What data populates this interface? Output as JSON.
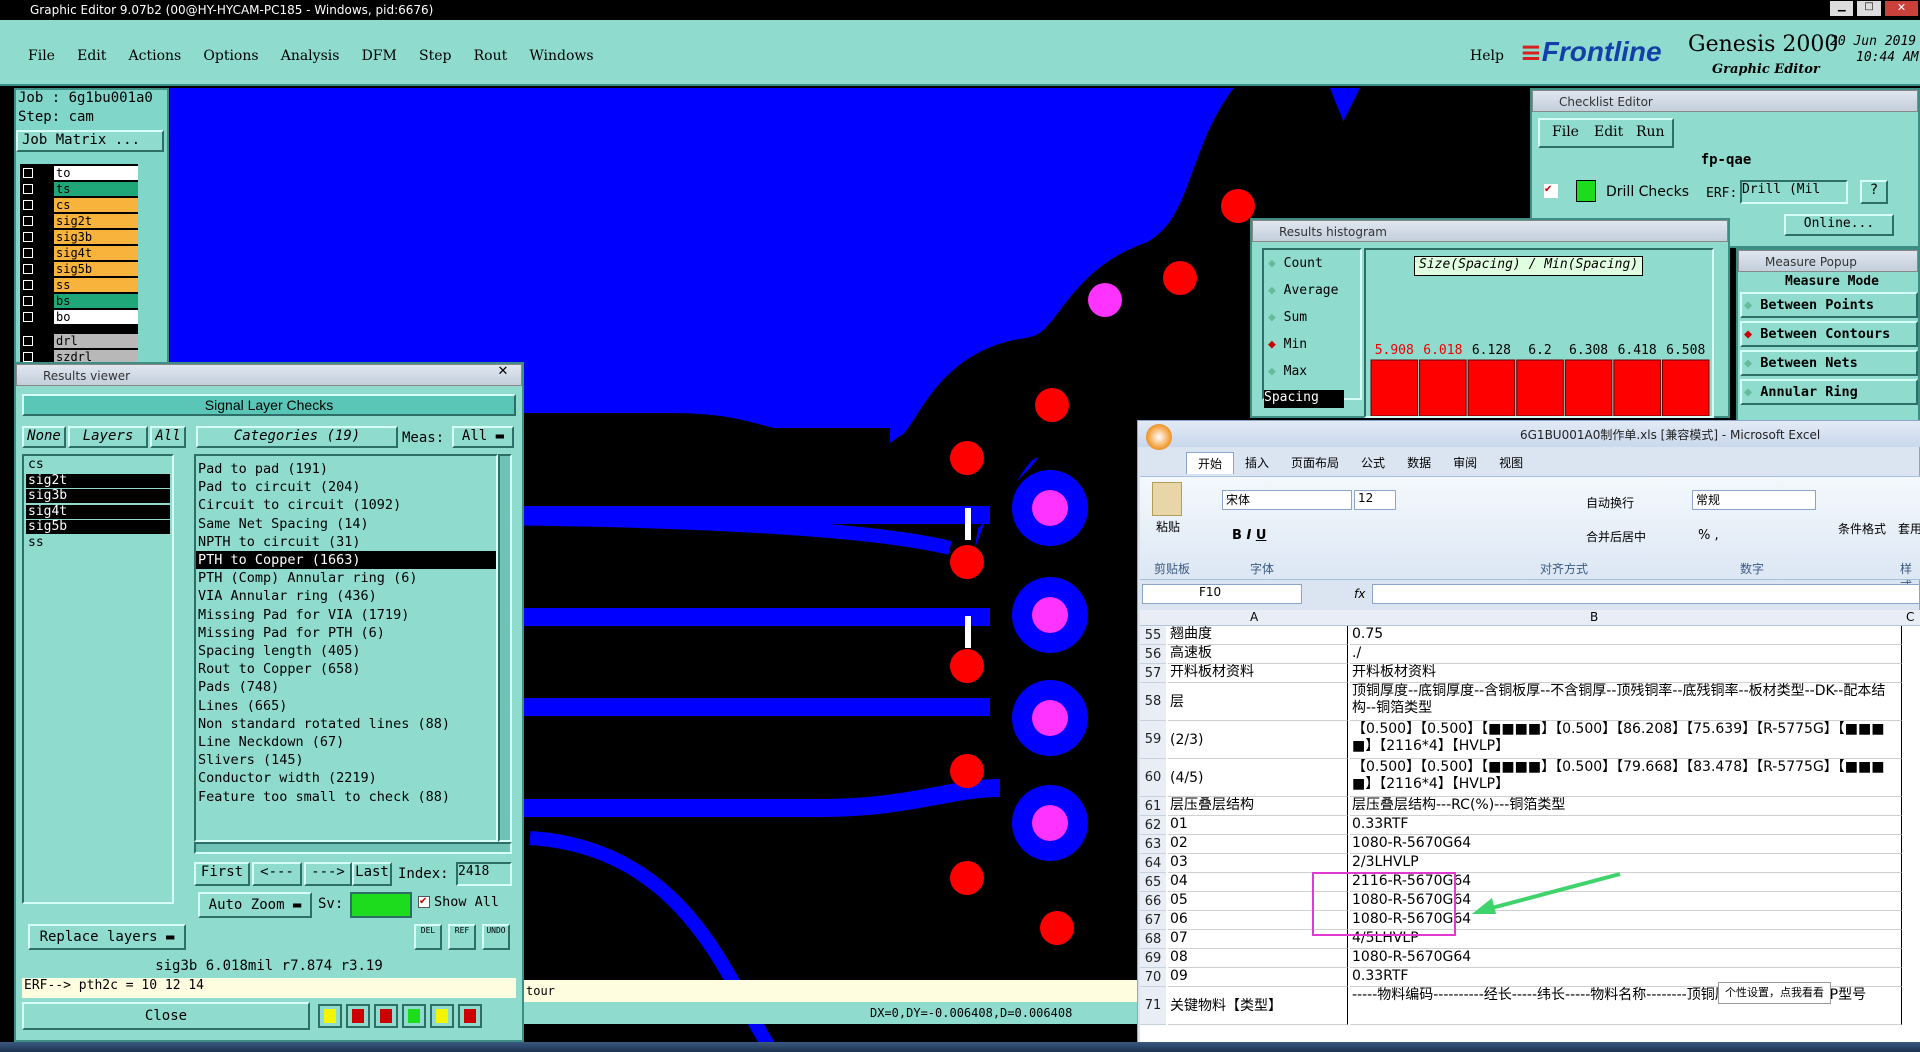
{
  "window": {
    "title": "Graphic Editor 9.07b2 (00@HY-HYCAM-PC185 - Windows, pid:6676)"
  },
  "menubar": {
    "items": [
      "File",
      "Edit",
      "Actions",
      "Options",
      "Analysis",
      "DFM",
      "Step",
      "Rout",
      "Windows"
    ],
    "help": "Help"
  },
  "brand": {
    "logo": "Frontline",
    "product": "Genesis 2000",
    "sub": "Graphic Editor",
    "date": "20 Jun 2019",
    "time": "10:44 AM"
  },
  "job": {
    "job": "Job : 6g1bu001a0",
    "step": "Step: cam",
    "matrix": "Job Matrix ..."
  },
  "layers": [
    {
      "name": "to",
      "color": "#ffffff"
    },
    {
      "name": "ts",
      "color": "#1fa77a"
    },
    {
      "name": "cs",
      "color": "#f7b33b"
    },
    {
      "name": "sig2t",
      "color": "#f7b33b"
    },
    {
      "name": "sig3b",
      "color": "#f7b33b"
    },
    {
      "name": "sig4t",
      "color": "#f7b33b"
    },
    {
      "name": "sig5b",
      "color": "#f7b33b"
    },
    {
      "name": "ss",
      "color": "#f7b33b"
    },
    {
      "name": "bs",
      "color": "#1fa77a"
    },
    {
      "name": "bo",
      "color": "#ffffff"
    },
    {
      "name": "drl",
      "color": "#b8b8b8"
    },
    {
      "name": "szdrl",
      "color": "#b8b8b8"
    }
  ],
  "results_viewer": {
    "title": "Results viewer",
    "header": "Signal Layer Checks",
    "none": "None",
    "layers": "Layers",
    "all": "All",
    "categories_label": "Categories (19)",
    "meas_label": "Meas:",
    "meas_value": "All",
    "layer_list": [
      "cs",
      "sig2t",
      "sig3b",
      "sig4t",
      "sig5b",
      "ss"
    ],
    "categories": [
      "Pad to pad (191)",
      "Pad to circuit (204)",
      "Circuit to circuit (1092)",
      "Same Net Spacing (14)",
      "NPTH to circuit (31)",
      "PTH to Copper (1663)",
      "PTH (Comp) Annular ring (6)",
      "VIA Annular ring (436)",
      "Missing Pad for VIA (1719)",
      "Missing Pad for PTH (6)",
      "Spacing length (405)",
      "Rout to Copper (658)",
      "Pads (748)",
      "Lines (665)",
      "Non standard rotated lines (88)",
      "Line Neckdown (67)",
      "Slivers (145)",
      "Conductor width (2219)",
      "Feature too small to check (88)"
    ],
    "selected_category": "PTH to Copper (1663)",
    "first": "First",
    "prev": "<---",
    "next": "--->",
    "last": "Last",
    "index_label": "Index:",
    "index_value": "2418",
    "auto_zoom": "Auto Zoom",
    "sv": "Sv:",
    "show_all": "Show All",
    "replace": "Replace layers",
    "status": "sig3b 6.018mil  r7.874  r3.19",
    "erf": "ERF--> pth2c = 10 12 14",
    "close": "Close",
    "icon_del": "DEL",
    "icon_ref": "REF",
    "icon_undo": "UNDO"
  },
  "checklist": {
    "title": "Checklist Editor",
    "menu": [
      "File",
      "Edit",
      "Run"
    ],
    "name": "fp-qae",
    "check": "Drill Checks",
    "erf": "ERF:",
    "erf_value": "Drill (Mil",
    "online": "Online..."
  },
  "histogram": {
    "title": "Results histogram",
    "options": [
      "Count",
      "Average",
      "Sum",
      "Min",
      "Max"
    ],
    "selected": "Min",
    "chart_title": "Size(Spacing) / Min(Spacing)",
    "spacing": "Spacing"
  },
  "chart_data": {
    "type": "bar",
    "title": "Size(Spacing) / Min(Spacing)",
    "categories": [
      "5.908",
      "6.018",
      "6.128",
      "6.2",
      "6.308",
      "6.418",
      "6.508"
    ],
    "values": [
      1,
      1,
      1,
      1,
      1,
      1,
      1
    ]
  },
  "measure": {
    "title": "Measure Popup",
    "mode": "Measure Mode",
    "options": [
      "Between Points",
      "Between Contours",
      "Between Nets",
      "Annular Ring"
    ],
    "selected": "Between Contours"
  },
  "excel": {
    "title": "6G1BU001A0制作单.xls [兼容模式] - Microsoft Excel",
    "tabs": [
      "开始",
      "插入",
      "页面布局",
      "公式",
      "数据",
      "审阅",
      "视图"
    ],
    "font": "宋体",
    "size": "12",
    "format": "常规",
    "wrap": "自动换行",
    "merge": "合并后居中",
    "groups": [
      "剪贴板",
      "字体",
      "对齐方式",
      "数字",
      "样式"
    ],
    "paste": "粘贴",
    "cond": "条件格式",
    "tblfmt": "套用表格格",
    "namebox": "F10",
    "fx": "fx",
    "cols": [
      "A",
      "B",
      "C"
    ],
    "rows": [
      {
        "n": "55",
        "a": "翘曲度",
        "b": "0.75"
      },
      {
        "n": "56",
        "a": "高速板",
        "b": "./"
      },
      {
        "n": "57",
        "a": "开料板材资料",
        "b": "开料板材资料"
      },
      {
        "n": "58",
        "a": "层",
        "b": "顶铜厚度--底铜厚度--含铜板厚--不含铜厚--顶残铜率--底残铜率--板材类型--DK--配本结构--铜箔类型"
      },
      {
        "n": "59",
        "a": "(2/3)",
        "b": "【0.500】【0.500】【■■■■】【0.500】【86.208】【75.639】【R-5775G】【■■■■】【2116*4】【HVLP】"
      },
      {
        "n": "60",
        "a": "(4/5)",
        "b": "【0.500】【0.500】【■■■■】【0.500】【79.668】【83.478】【R-5775G】【■■■■】【2116*4】【HVLP】"
      },
      {
        "n": "61",
        "a": "层压叠层结构",
        "b": "层压叠层结构---RC(%)---铜箔类型"
      },
      {
        "n": "62",
        "a": "01",
        "b": "0.33RTF"
      },
      {
        "n": "63",
        "a": "02",
        "b": "1080-R-5670G64"
      },
      {
        "n": "64",
        "a": "03",
        "b": "2/3LHVLP"
      },
      {
        "n": "65",
        "a": "04",
        "b": "2116-R-5670G64"
      },
      {
        "n": "66",
        "a": "05",
        "b": "1080-R-5670G64"
      },
      {
        "n": "67",
        "a": "06",
        "b": "1080-R-5670G64"
      },
      {
        "n": "68",
        "a": "07",
        "b": "4/5LHVLP"
      },
      {
        "n": "69",
        "a": "08",
        "b": "1080-R-5670G64"
      },
      {
        "n": "70",
        "a": "09",
        "b": "0.33RTF"
      },
      {
        "n": "71",
        "a": "关键物料【类型】",
        "b": "-----物料编码----------经长-----纬长-----物料名称--------顶铜厚-----底铜厚-----PP型号"
      }
    ],
    "tooltip": "个性设置，点我看看"
  },
  "canvas": {
    "status_tail": "tour",
    "coords": "DX=0,DY=-0.006408,D=0.006408"
  }
}
